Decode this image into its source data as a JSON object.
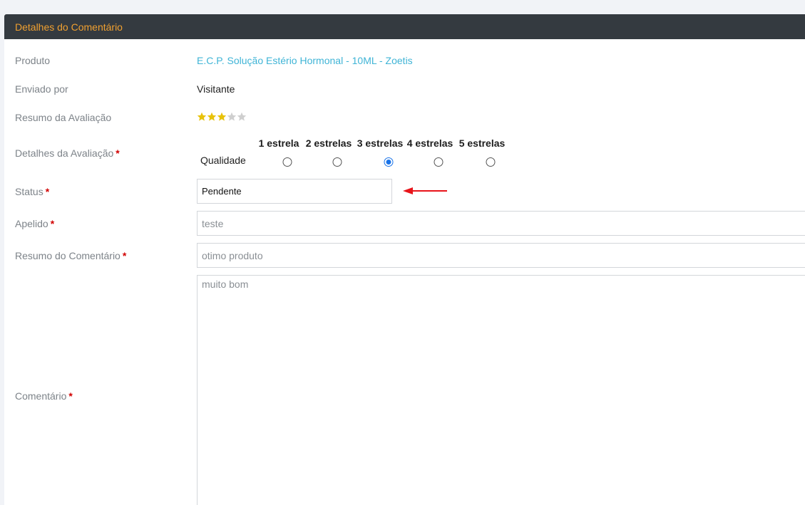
{
  "panel": {
    "title": "Detalhes do Comentário"
  },
  "product": {
    "label": "Produto",
    "value": "E.C.P. Solução Estério Hormonal - 10ML - Zoetis"
  },
  "sent_by": {
    "label": "Enviado por",
    "value": "Visitante"
  },
  "rating_summary": {
    "label": "Resumo da Avaliação",
    "stars_filled": 3,
    "stars_total": 5,
    "filled_color": "#e8c20a",
    "empty_color": "#cfcfcf"
  },
  "rating_details": {
    "label": "Detalhes da Avaliação",
    "required_mark": "*",
    "row_label": "Qualidade",
    "options": [
      "1 estrela",
      "2 estrelas",
      "3 estrelas",
      "4 estrelas",
      "5 estrelas"
    ],
    "selected_index": 2
  },
  "status": {
    "label": "Status",
    "required_mark": "*",
    "value": "Pendente"
  },
  "nickname": {
    "label": "Apelido",
    "required_mark": "*",
    "value": "teste"
  },
  "summary": {
    "label": "Resumo do Comentário",
    "required_mark": "*",
    "value": "otimo produto"
  },
  "comment": {
    "label": "Comentário",
    "required_mark": "*",
    "value": "muito bom"
  },
  "annotation": {
    "arrow_color": "#e8141a"
  }
}
